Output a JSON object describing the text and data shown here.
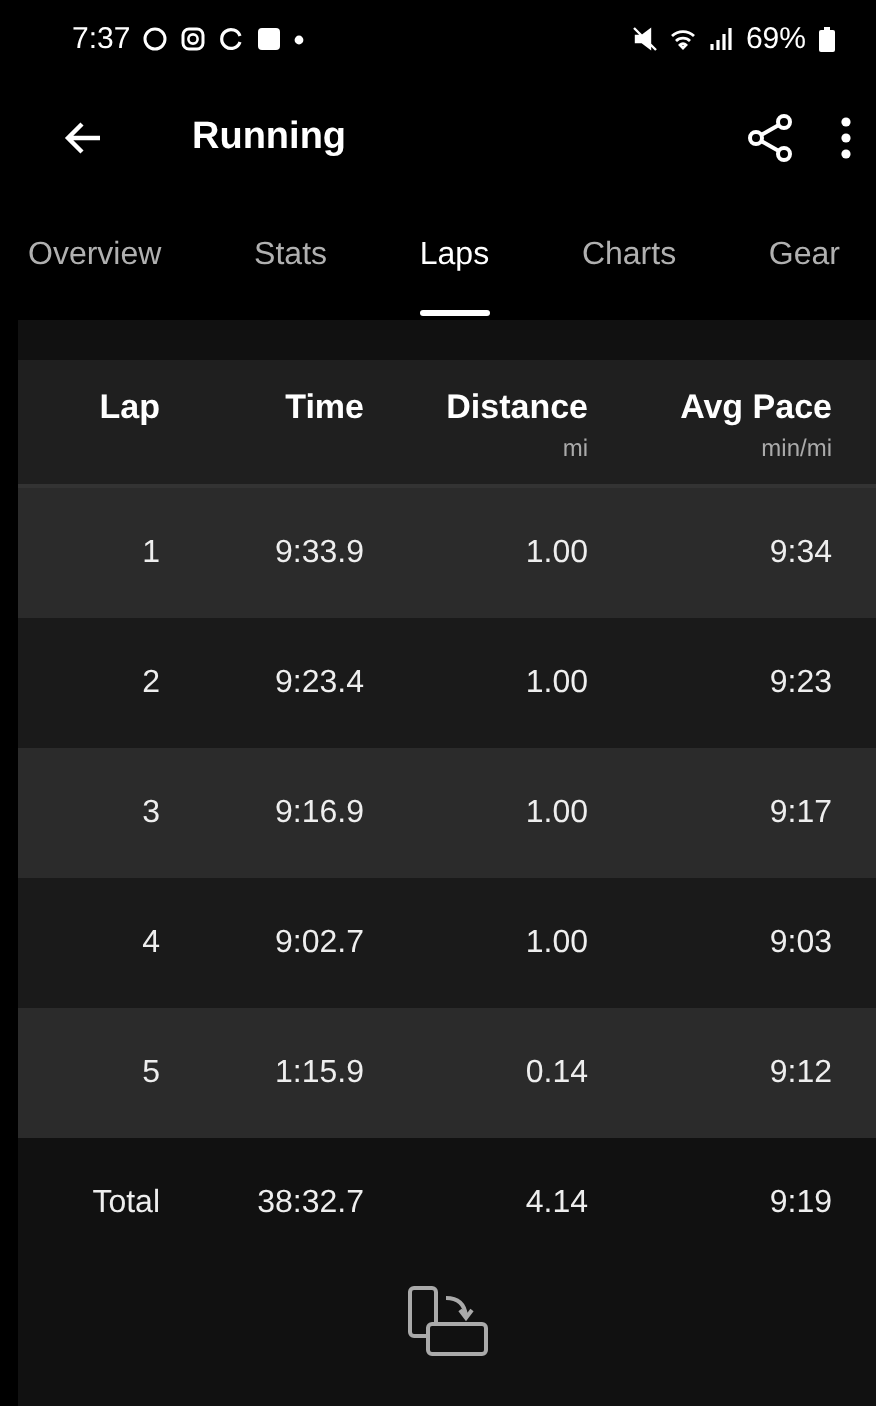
{
  "status_bar": {
    "time": "7:37",
    "battery": "69%"
  },
  "app_bar": {
    "title": "Running"
  },
  "tabs": [
    {
      "label": "Overview",
      "selected": false
    },
    {
      "label": "Stats",
      "selected": false
    },
    {
      "label": "Laps",
      "selected": true
    },
    {
      "label": "Charts",
      "selected": false
    },
    {
      "label": "Gear",
      "selected": false
    }
  ],
  "table": {
    "columns": [
      {
        "label": "Lap"
      },
      {
        "label": "Time"
      },
      {
        "label": "Distance",
        "unit": "mi"
      },
      {
        "label": "Avg Pace",
        "unit": "min/mi"
      }
    ],
    "rows": [
      {
        "kind": "lap",
        "cells": [
          "1",
          "9:33.9",
          "1.00",
          "9:34"
        ]
      },
      {
        "kind": "lap",
        "cells": [
          "2",
          "9:23.4",
          "1.00",
          "9:23"
        ]
      },
      {
        "kind": "lap",
        "cells": [
          "3",
          "9:16.9",
          "1.00",
          "9:17"
        ]
      },
      {
        "kind": "lap",
        "cells": [
          "4",
          "9:02.7",
          "1.00",
          "9:03"
        ]
      },
      {
        "kind": "lap",
        "cells": [
          "5",
          "1:15.9",
          "0.14",
          "9:12"
        ]
      },
      {
        "kind": "total",
        "cells": [
          "Total",
          "38:32.7",
          "4.14",
          "9:19"
        ]
      }
    ]
  }
}
